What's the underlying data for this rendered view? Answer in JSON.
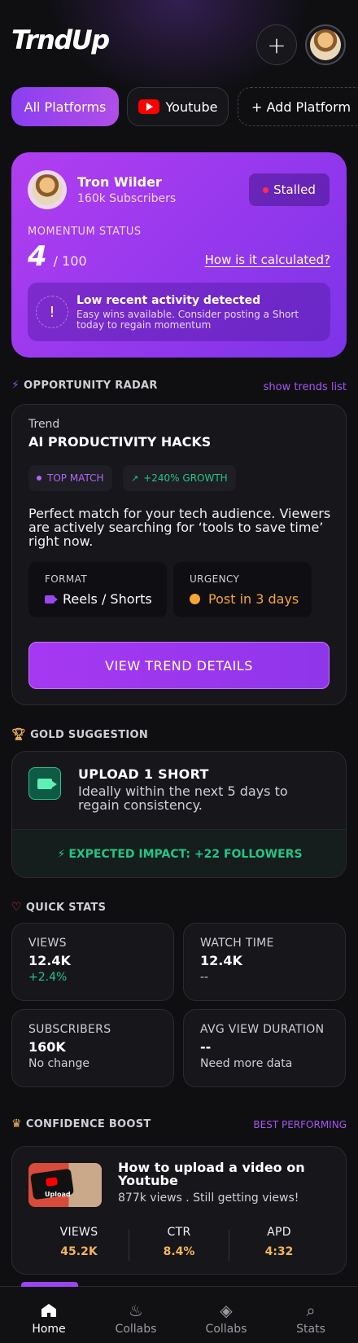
{
  "app": {
    "logo": "TrndUp"
  },
  "header": {
    "add_icon": "plus-icon",
    "profile_icon": "avatar"
  },
  "tabs": [
    {
      "label": "All Platforms",
      "active": true
    },
    {
      "label": "Youtube",
      "icon": "youtube-icon"
    },
    {
      "label": "+ Add Platform"
    }
  ],
  "creator": {
    "name": "Tron Wilder",
    "subscribers": "160k Subscribers",
    "status": "Stalled",
    "momentum_label": "MOMENTUM STATUS",
    "momentum_score": "4",
    "momentum_of": "/ 100",
    "how_link": "How is it calculated?",
    "alert_icon": "!",
    "alert_title": "Low recent activity detected",
    "alert_desc": "Easy wins available. Consider posting a Short today to regain momentum"
  },
  "radar": {
    "section_title": "OPPORTUNITY RADAR",
    "section_link": "show trends list",
    "trend_label": "Trend",
    "trend_title": "AI PRODUCTIVITY HACKS",
    "badge_match": "TOP MATCH",
    "badge_growth": "+240% GROWTH",
    "growth_arrow": "↗",
    "description": "Perfect match for your tech audience. Viewers are actively searching for ‘tools to save time’ right now.",
    "format_label": "FORMAT",
    "format_value": "Reels / Shorts",
    "urgency_label": "URGENCY",
    "urgency_value": "Post in 3 days",
    "cta": "VIEW TREND DETAILS"
  },
  "gold": {
    "section_title": "GOLD SUGGESTION",
    "title": "UPLOAD 1 SHORT",
    "desc": "Ideally within the next 5 days to regain consistency.",
    "impact": "EXPECTED IMPACT: +22 FOLLOWERS"
  },
  "quick_stats": {
    "section_title": "QUICK STATS",
    "items": [
      {
        "label": "VIEWS",
        "value": "12.4K",
        "sub": "+2.4%"
      },
      {
        "label": "WATCH TIME",
        "value": "12.4K",
        "sub": "--"
      },
      {
        "label": "SUBSCRIBERS",
        "value": "160K",
        "sub": "No change"
      },
      {
        "label": "AVG VIEW DURATION",
        "value": "--",
        "sub": "Need more data"
      }
    ]
  },
  "confidence": {
    "section_title": "CONFIDENCE BOOST",
    "section_link": "BEST PERFORMING",
    "thumb_text": "Upload",
    "video_title": "How to upload a video on Youtube",
    "video_sub": "877k views . Still getting views!",
    "stats": [
      {
        "label": "VIEWS",
        "value": "45.2K"
      },
      {
        "label": "CTR",
        "value": "8.4%"
      },
      {
        "label": "APD",
        "value": "4:32"
      }
    ]
  },
  "nav": [
    {
      "label": "Home",
      "icon": "home-icon",
      "active": true
    },
    {
      "label": "Collabs",
      "icon": "flame-icon"
    },
    {
      "label": "Collabs",
      "icon": "handshake-icon"
    },
    {
      "label": "Stats",
      "icon": "stats-icon"
    }
  ]
}
